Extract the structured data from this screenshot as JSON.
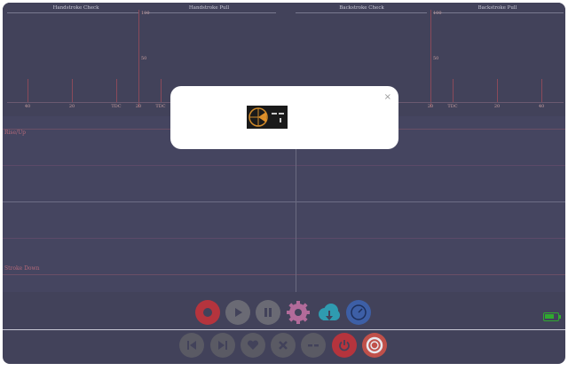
{
  "charts": {
    "titles": [
      "Handstroke Check",
      "Handstroke Pull",
      "Backstroke Check",
      "Backstroke Pull"
    ],
    "left": {
      "y_top_label": "100",
      "y_mid_label": "50",
      "x_labels": [
        "40",
        "20",
        "TDC",
        "20",
        "TDC"
      ]
    },
    "right": {
      "y_top_label": "100",
      "y_mid_label": "50",
      "x_labels": [
        "20",
        "TDC",
        "20",
        "40"
      ]
    }
  },
  "timeline": {
    "label_top": "Rise/Up",
    "label_bottom": "Stroke Down"
  },
  "toolbar_top": {
    "buttons": [
      {
        "name": "record-button",
        "icon": "record-icon",
        "color": "#b5343d"
      },
      {
        "name": "play-button",
        "icon": "play-icon",
        "color": "#6a6a74"
      },
      {
        "name": "pause-button",
        "icon": "pause-icon",
        "color": "#6a6a74"
      },
      {
        "name": "settings-button",
        "icon": "gear-icon",
        "color": "#b26b9a"
      },
      {
        "name": "download-button",
        "icon": "cloud-download-icon",
        "color": "#2f9bb0"
      },
      {
        "name": "gauge-button",
        "icon": "gauge-icon",
        "color": "#3d5fa6"
      }
    ]
  },
  "toolbar_bottom": {
    "buttons": [
      {
        "name": "skip-back-button",
        "icon": "skip-back-icon",
        "color": "#5a5a64"
      },
      {
        "name": "skip-forward-button",
        "icon": "skip-forward-icon",
        "color": "#5a5a64"
      },
      {
        "name": "favorite-button",
        "icon": "heart-icon",
        "color": "#5a5a64"
      },
      {
        "name": "delete-button",
        "icon": "x-icon",
        "color": "#5a5a64"
      },
      {
        "name": "more-button",
        "icon": "dash-icon",
        "color": "#5a5a64"
      },
      {
        "name": "power-button",
        "icon": "power-icon",
        "color": "#b5343d"
      },
      {
        "name": "help-button",
        "icon": "lifebuoy-icon",
        "color": "#c0504a"
      }
    ]
  },
  "status": {
    "battery_level": 0.6,
    "battery_color": "#2faa2f"
  },
  "modal": {
    "close_label": "×",
    "thumbnail": "app-preview-thumbnail"
  }
}
